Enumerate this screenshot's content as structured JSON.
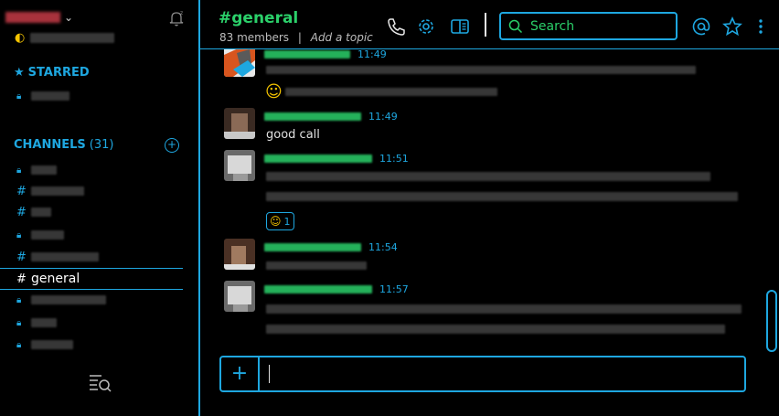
{
  "sidebar": {
    "starred_label": "STARRED",
    "channels_label": "CHANNELS",
    "channels_count": "(31)",
    "active_channel": "general"
  },
  "header": {
    "channel_name": "#general",
    "member_count": "83 members",
    "separator": "|",
    "add_topic": "Add a topic",
    "search_placeholder": "Search"
  },
  "messages": [
    {
      "time": "11:49",
      "text": ""
    },
    {
      "time": "11:49",
      "text": "good call"
    },
    {
      "time": "11:51",
      "text": "",
      "reaction_count": "1"
    },
    {
      "time": "11:54",
      "text": ""
    },
    {
      "time": "11:57",
      "text": ""
    }
  ],
  "composer": {
    "value": ""
  },
  "colors": {
    "accent": "#1ea7e0",
    "green": "#2bd06a",
    "background": "#000000"
  }
}
